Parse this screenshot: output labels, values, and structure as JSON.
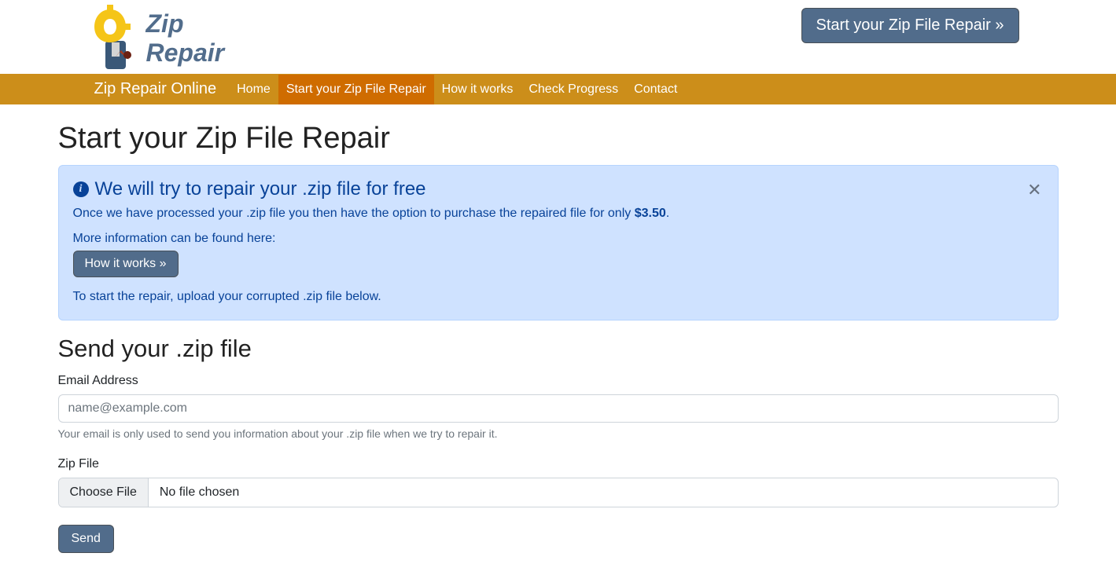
{
  "header": {
    "logo_line1": "Zip",
    "logo_line2": "Repair",
    "cta_label": "Start your Zip File Repair »"
  },
  "nav": {
    "brand": "Zip Repair Online",
    "items": [
      {
        "label": "Home",
        "active": false
      },
      {
        "label": "Start your Zip File Repair",
        "active": true
      },
      {
        "label": "How it works",
        "active": false
      },
      {
        "label": "Check Progress",
        "active": false
      },
      {
        "label": "Contact",
        "active": false
      }
    ]
  },
  "page": {
    "title": "Start your Zip File Repair"
  },
  "alert": {
    "heading": "We will try to repair your .zip file for free",
    "line1_prefix": "Once we have processed your .zip file you then have the option to purchase the repaired file for only ",
    "price": "$3.50",
    "line1_suffix": ".",
    "line2": "More information can be found here:",
    "button": "How it works »",
    "line3": "To start the repair, upload your corrupted .zip file below."
  },
  "form": {
    "section_title": "Send your .zip file",
    "email_label": "Email Address",
    "email_placeholder": "name@example.com",
    "email_hint": "Your email is only used to send you information about your .zip file when we try to repair it.",
    "file_label": "Zip File",
    "file_button": "Choose File",
    "file_text": "No file chosen",
    "submit": "Send"
  }
}
